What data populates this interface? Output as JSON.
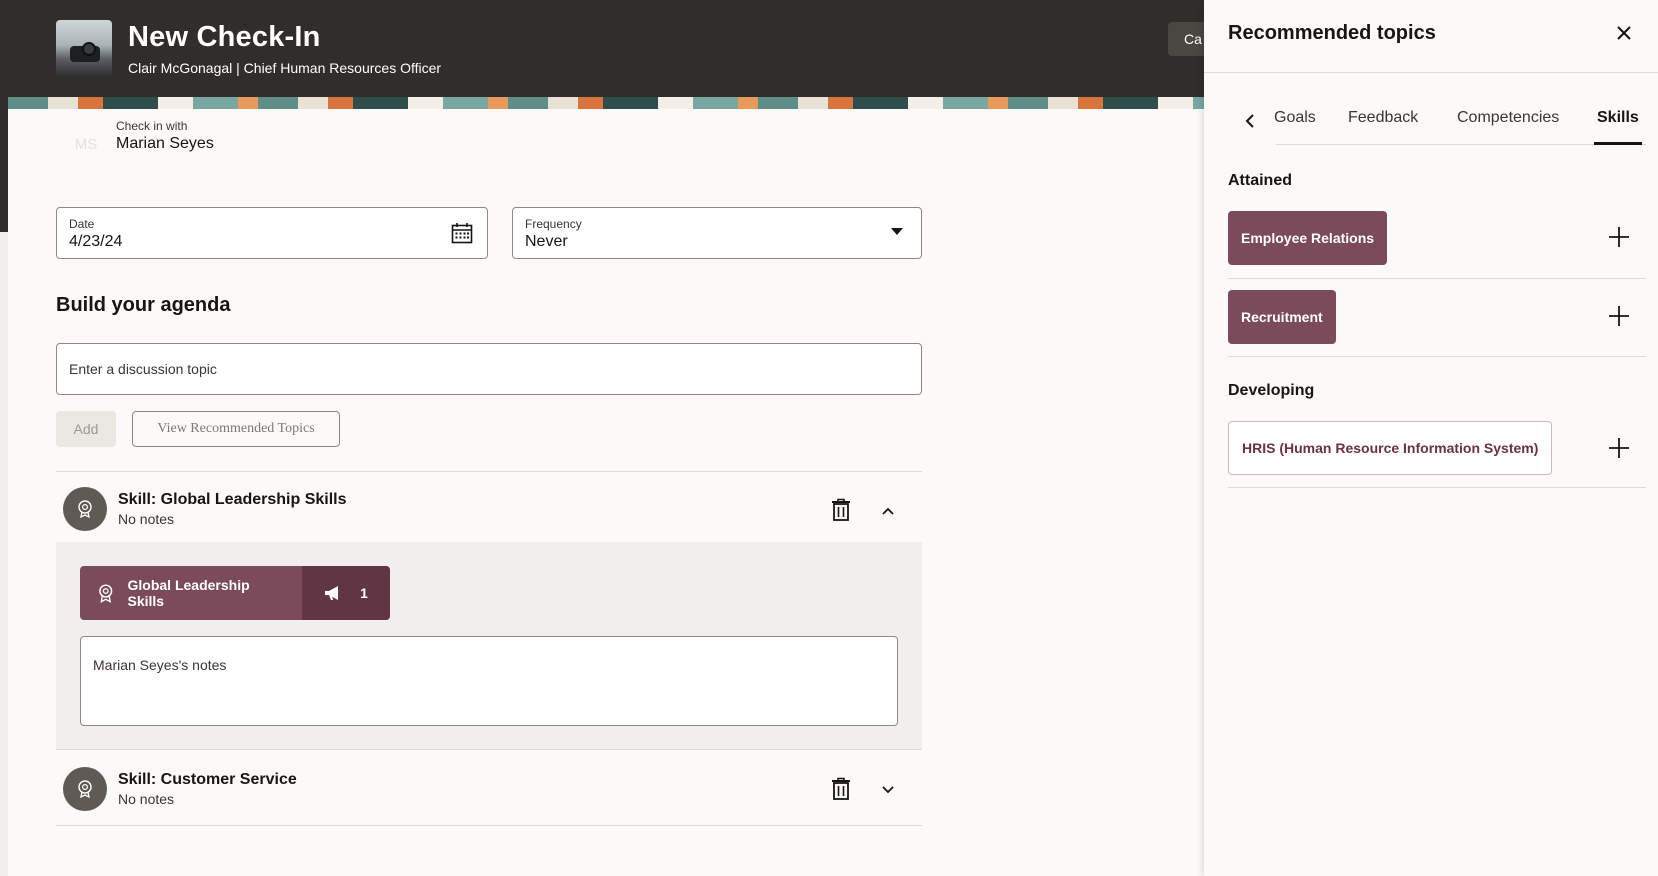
{
  "header": {
    "title": "New Check-In",
    "subtitle": "Clair McGonagal | Chief Human Resources Officer",
    "cancel_label": "Ca"
  },
  "checkin": {
    "label": "Check in with",
    "name": "Marian Seyes",
    "initials": "MS"
  },
  "date": {
    "label": "Date",
    "value": "4/23/24"
  },
  "frequency": {
    "label": "Frequency",
    "value": "Never"
  },
  "agenda": {
    "title": "Build your agenda",
    "input_placeholder": "Enter a discussion topic",
    "add_label": "Add",
    "view_label": "View Recommended Topics"
  },
  "items": [
    {
      "title": "Skill: Global Leadership Skills",
      "sub": "No notes"
    },
    {
      "title": "Skill: Customer Service",
      "sub": "No notes"
    }
  ],
  "expanded": {
    "chip_label": "Global Leadership Skills",
    "chip_count": "1",
    "notes_placeholder": "Marian Seyes's notes"
  },
  "drawer": {
    "title": "Recommended topics",
    "tabs": [
      "Goals",
      "Feedback",
      "Competencies",
      "Skills"
    ],
    "active_tab": "Skills",
    "attained_title": "Attained",
    "attained": [
      "Employee Relations",
      "Recruitment"
    ],
    "developing_title": "Developing",
    "developing": [
      "HRIS (Human Resource Information System)"
    ]
  },
  "colors": {
    "header_bg": "#312d2a",
    "chip_bg": "#7c4b5b",
    "chip_count_bg": "#613543",
    "chip_outline_text": "#6b3146"
  },
  "icons": [
    "calendar-icon",
    "chevron-down-icon",
    "skill-badge-icon",
    "trash-icon",
    "chevron-up-icon",
    "megaphone-icon",
    "close-icon",
    "chevron-left-icon",
    "plus-icon"
  ]
}
